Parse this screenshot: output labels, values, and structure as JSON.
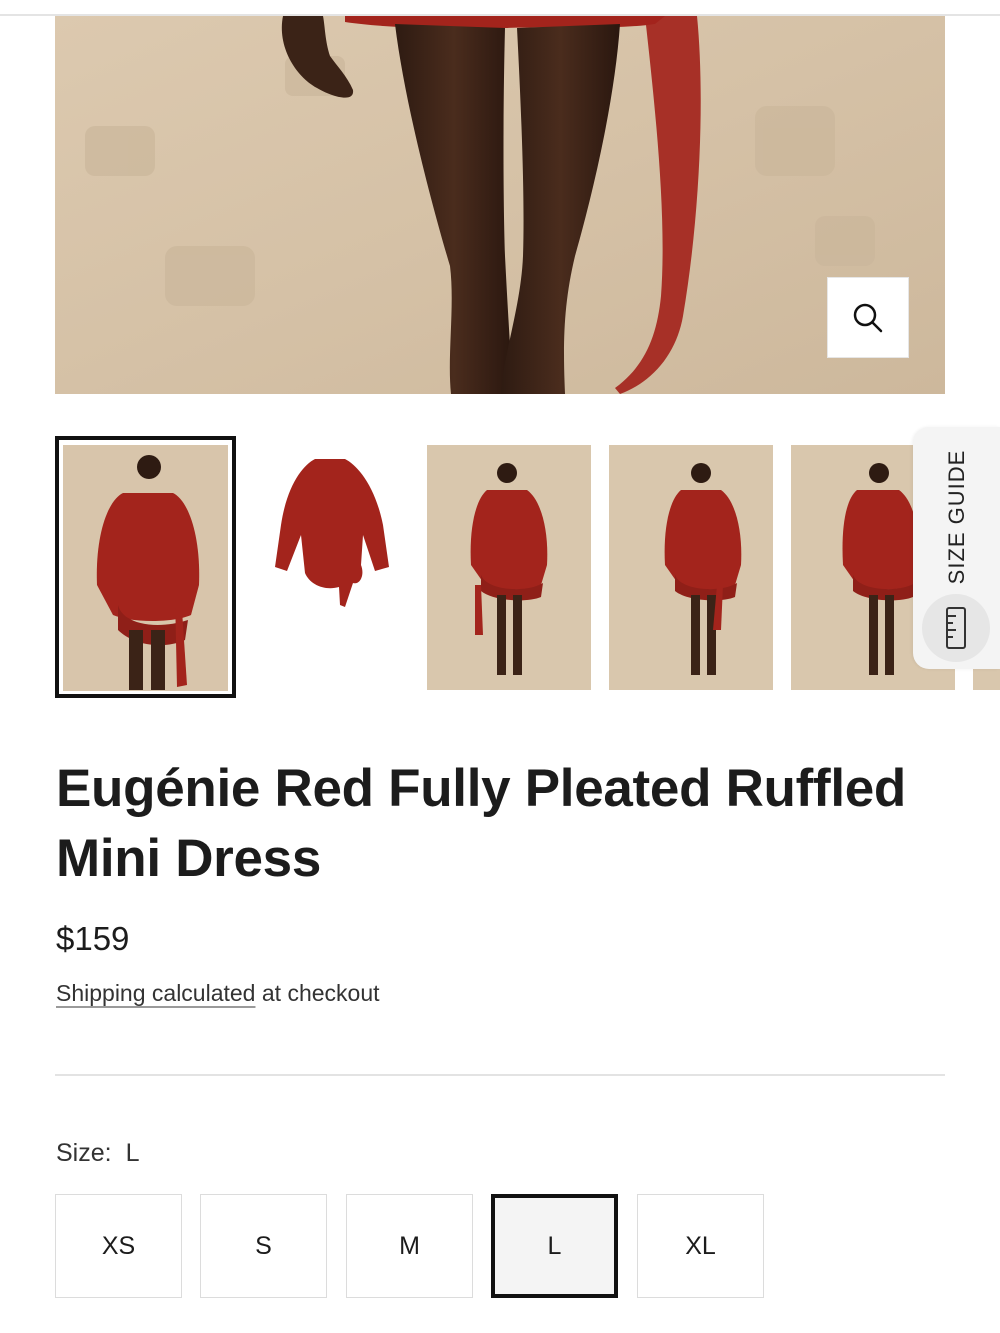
{
  "gallery": {
    "zoom_icon": "search-icon",
    "thumbnails": [
      {
        "view": "front",
        "active": true
      },
      {
        "view": "flat-lay",
        "active": false
      },
      {
        "view": "back",
        "active": false
      },
      {
        "view": "front",
        "active": false
      },
      {
        "view": "side",
        "active": false
      }
    ]
  },
  "size_guide": {
    "label": "SIZE GUIDE",
    "icon": "ruler-icon"
  },
  "product": {
    "title": "Eugénie Red Fully Pleated Ruffled Mini Dress",
    "price": "$159",
    "shipping_link": "Shipping calculated",
    "shipping_rest": " at checkout"
  },
  "size": {
    "label": "Size:",
    "selected": "L",
    "options": [
      "XS",
      "S",
      "M",
      "L",
      "XL"
    ]
  },
  "colors": {
    "dress_red": "#a3241c",
    "backdrop": "#d8c5ab",
    "selected_border": "#111111"
  }
}
